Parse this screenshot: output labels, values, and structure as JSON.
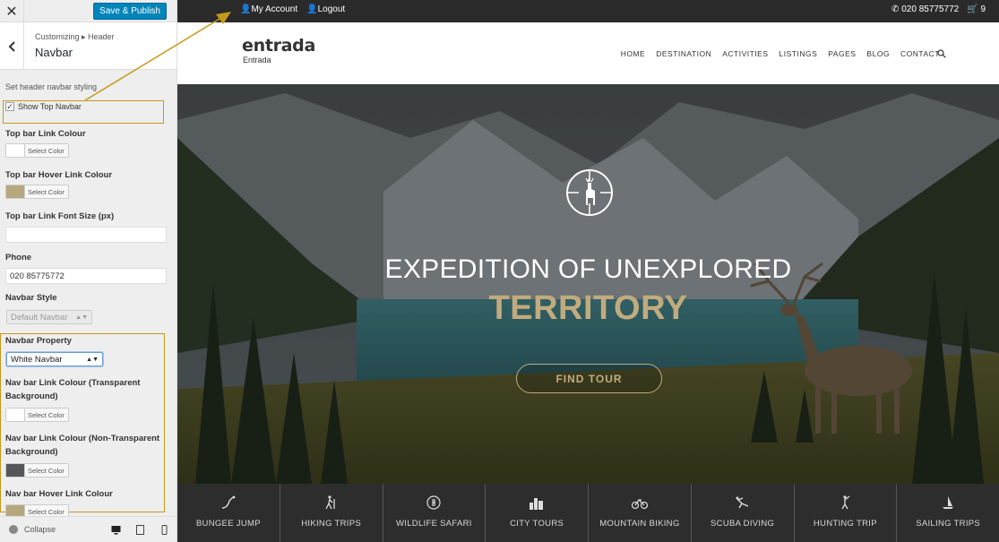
{
  "customizer": {
    "close_glyph": "✕",
    "save_label": "Save & Publish",
    "breadcrumb": "Customizing ▸ Header",
    "section_title": "Navbar",
    "description": "Set header navbar styling",
    "show_top_navbar_label": "Show Top Navbar",
    "show_top_navbar_checked": true,
    "fields": {
      "top_link_colour": {
        "label": "Top bar Link Colour",
        "button": "Select Color",
        "color": "#ffffff"
      },
      "top_hover_colour": {
        "label": "Top bar Hover Link Colour",
        "button": "Select Color",
        "color": "#b7a77e"
      },
      "top_font_size": {
        "label": "Top bar Link Font Size (px)",
        "value": ""
      },
      "phone": {
        "label": "Phone",
        "value": "020 85775772"
      },
      "navbar_style": {
        "label": "Navbar Style",
        "value": "Default Navbar"
      },
      "navbar_property": {
        "label": "Navbar Property",
        "value": "White Navbar"
      },
      "nav_link_transparent": {
        "label_line1": "Nav bar Link Colour (Transparent",
        "label_line2": "Background)",
        "button": "Select Color",
        "color": "#ffffff"
      },
      "nav_link_nontransparent": {
        "label_line1": "Nav bar Link Colour (Non-Transparent",
        "label_line2": "Background)",
        "button": "Select Color",
        "color": "#55575a"
      },
      "nav_hover": {
        "label": "Nav bar Hover Link Colour",
        "button": "Select Color",
        "color": "#b7a77e"
      }
    },
    "collapse_label": "Collapse",
    "highlight_color": "#c49a1a",
    "save_color": "#0085ba"
  },
  "site": {
    "topbar": {
      "my_account": "My Account",
      "logout": "Logout",
      "phone": "020 85775772",
      "cart_count": "9"
    },
    "logo": "entrada",
    "logo_sub": "Entrada",
    "menu": [
      "HOME",
      "DESTINATION",
      "ACTIVITIES",
      "LISTINGS",
      "PAGES",
      "BLOG",
      "CONTACT"
    ],
    "hero": {
      "line1": "EXPEDITION OF UNEXPLORED",
      "line2": "TERRITORY",
      "button": "FIND TOUR",
      "accent": "#c1ab7e"
    },
    "categories": [
      {
        "label": "BUNGEE JUMP",
        "icon": "bungee-icon"
      },
      {
        "label": "HIKING TRIPS",
        "icon": "hiker-icon"
      },
      {
        "label": "WILDLIFE SAFARI",
        "icon": "deer-icon"
      },
      {
        "label": "CITY TOURS",
        "icon": "city-icon"
      },
      {
        "label": "MOUNTAIN BIKING",
        "icon": "bike-icon"
      },
      {
        "label": "SCUBA DIVING",
        "icon": "diver-icon"
      },
      {
        "label": "HUNTING TRIP",
        "icon": "hunter-icon"
      },
      {
        "label": "SAILING TRIPS",
        "icon": "sail-icon"
      }
    ]
  }
}
